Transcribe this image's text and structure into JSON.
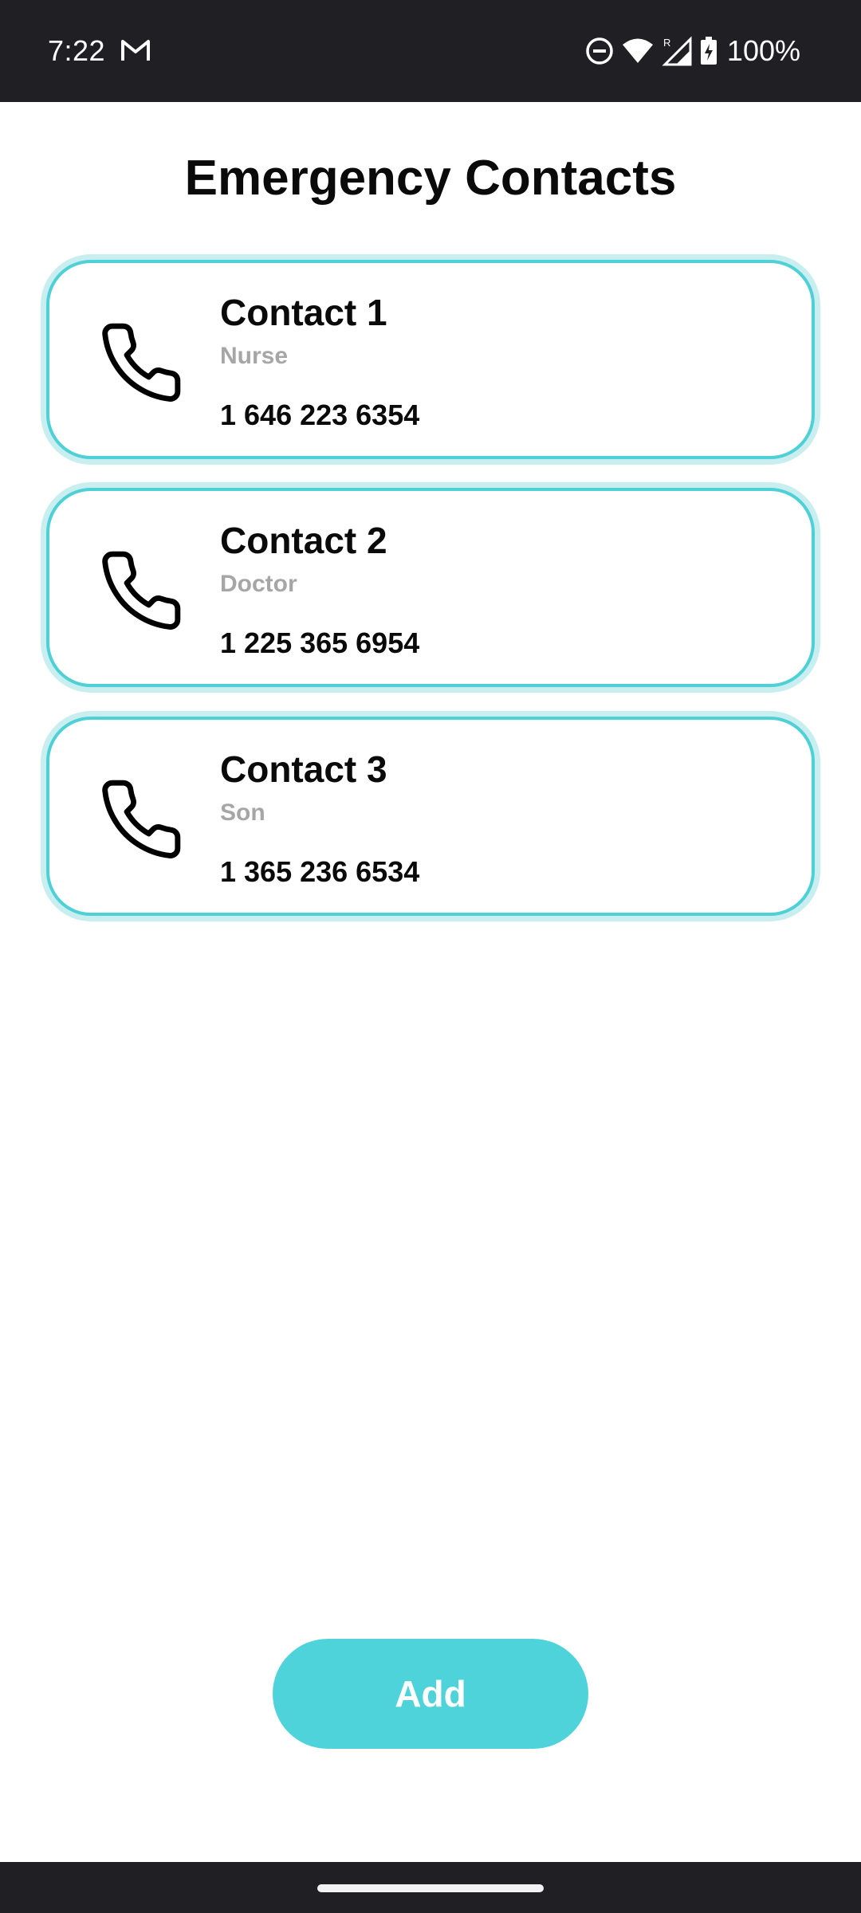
{
  "status_bar": {
    "time": "7:22",
    "battery": "100%",
    "icons": [
      "gmail-icon",
      "do-not-disturb-icon",
      "wifi-icon",
      "signal-icon",
      "battery-charging-icon"
    ]
  },
  "header": {
    "title": "Emergency Contacts"
  },
  "contacts": [
    {
      "name": "Contact 1",
      "role": "Nurse",
      "phone": "1 646 223 6354",
      "icon": "phone-icon"
    },
    {
      "name": "Contact 2",
      "role": "Doctor",
      "phone": "1 225 365 6954",
      "icon": "phone-icon"
    },
    {
      "name": "Contact 3",
      "role": "Son",
      "phone": "1 365 236 6534",
      "icon": "phone-icon"
    }
  ],
  "actions": {
    "add_label": "Add"
  },
  "colors": {
    "accent": "#4fd3da",
    "card_border": "#4fd0d6",
    "card_glow": "#c8eef0",
    "system_bar": "#1f1f24",
    "muted_text": "#a6a6a6"
  }
}
